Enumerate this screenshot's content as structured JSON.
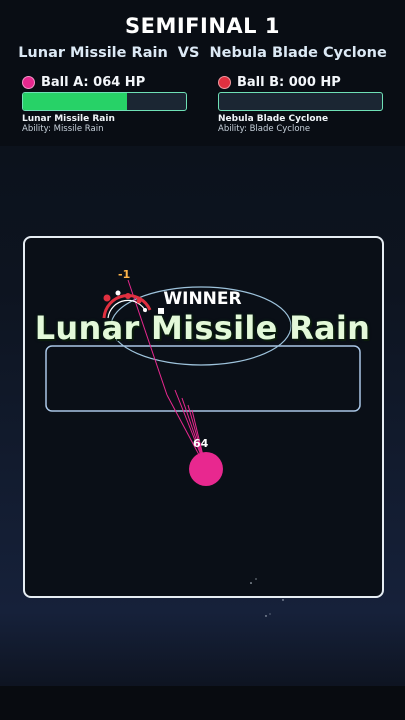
{
  "header": {
    "title": "SEMIFINAL 1",
    "fighter_a": "Lunar Missile Rain",
    "vs": "VS",
    "fighter_b": "Nebula Blade Cyclone"
  },
  "ball_a": {
    "label": "Ball A: 064 HP",
    "name": "Lunar Missile Rain",
    "ability": "Ability: Missile Rain",
    "hp_fraction": 0.64,
    "color": "#e8288f"
  },
  "ball_b": {
    "label": "Ball B: 000 HP",
    "name": "Nebula Blade Cyclone",
    "ability": "Ability: Blade Cyclone",
    "hp_fraction": 0.0,
    "color": "#e03040"
  },
  "result": {
    "winner_label": "WINNER",
    "winner_name": "Lunar Missile Rain"
  },
  "arena": {
    "ball_hp_text": "64",
    "damage_text": "-1"
  },
  "colors": {
    "hp_fill": "#27d267",
    "hp_border": "#6fe0b6",
    "arena_border": "#e6edf3",
    "inner_rect": "#a9c6e6"
  }
}
